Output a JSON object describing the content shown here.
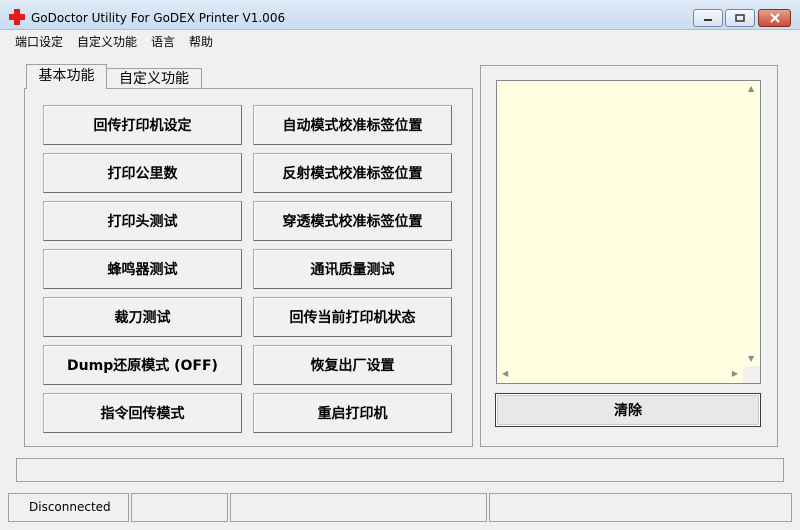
{
  "window": {
    "title": "GoDoctor Utility For GoDEX Printer  V1.006",
    "icon": "red-cross-icon"
  },
  "menu": {
    "items": [
      "端口设定",
      "自定义功能",
      "语言",
      "帮助"
    ]
  },
  "tabs": {
    "active": "基本功能",
    "inactive": "自定义功能"
  },
  "buttons": {
    "left": [
      "回传打印机设定",
      "打印公里数",
      "打印头测试",
      "蜂鸣器测试",
      "裁刀测试",
      "Dump还原模式 (OFF)",
      "指令回传模式"
    ],
    "right": [
      "自动模式校准标签位置",
      "反射模式校准标签位置",
      "穿透模式校准标签位置",
      "通讯质量测试",
      "回传当前打印机状态",
      "恢复出厂设置",
      "重启打印机"
    ]
  },
  "log": {
    "text": "",
    "background": "#fffee0"
  },
  "clear_button": "清除",
  "status": {
    "connection": "Disconnected"
  }
}
